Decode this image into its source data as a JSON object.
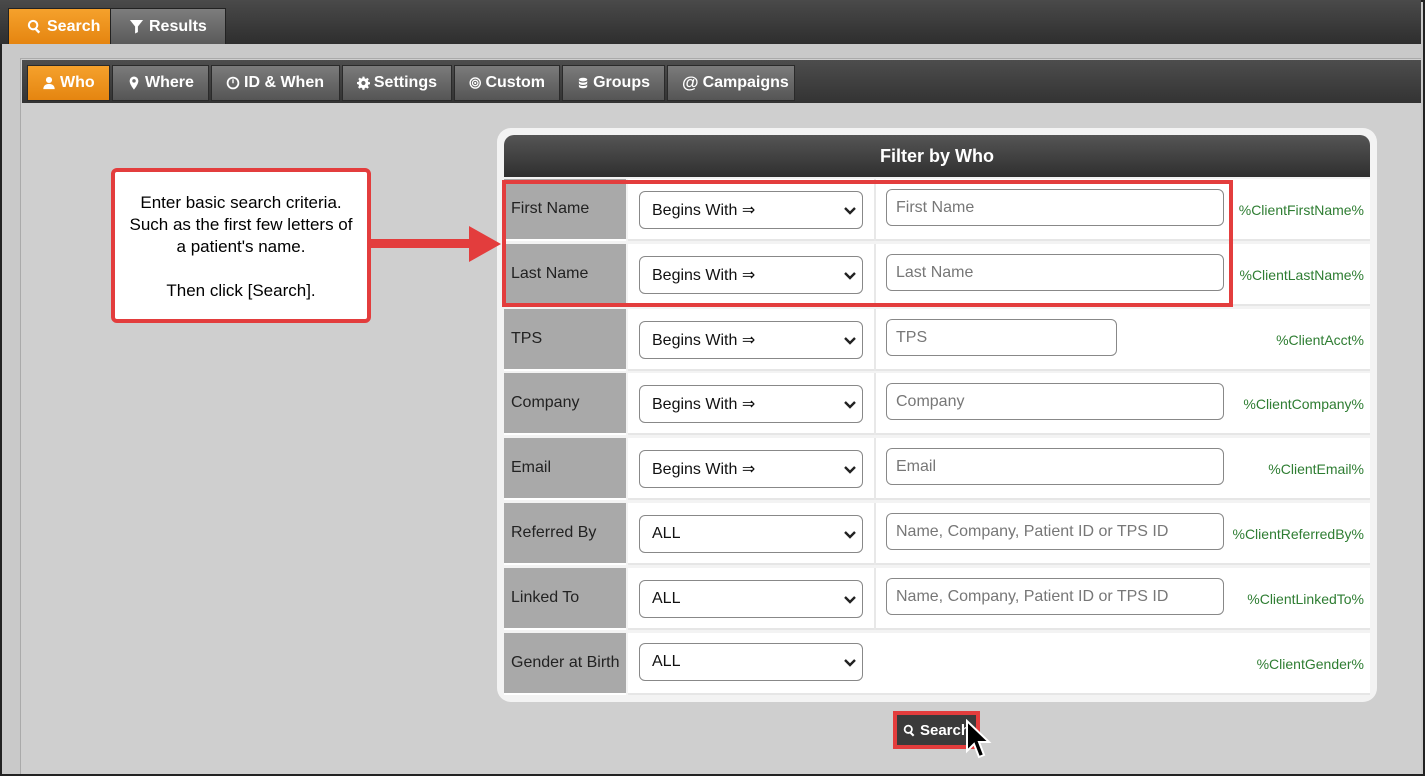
{
  "top_tabs": [
    {
      "label": "Search",
      "icon": "search-icon",
      "active": true
    },
    {
      "label": "Results",
      "icon": "filter-icon",
      "active": false
    }
  ],
  "sub_tabs": [
    {
      "label": "Who",
      "icon": "user-icon",
      "active": true
    },
    {
      "label": "Where",
      "icon": "map-pin-icon",
      "active": false
    },
    {
      "label": "ID & When",
      "icon": "clock-icon",
      "active": false
    },
    {
      "label": "Settings",
      "icon": "gear-icon",
      "active": false
    },
    {
      "label": "Custom",
      "icon": "bullseye-icon",
      "active": false
    },
    {
      "label": "Groups",
      "icon": "groups-icon",
      "active": false
    },
    {
      "label": "Campaigns",
      "icon": "at-icon",
      "active": false
    }
  ],
  "panel": {
    "title": "Filter by Who",
    "rows": [
      {
        "label": "First Name",
        "operator": "Begins With ⇒",
        "placeholder": "First Name",
        "variable": "%ClientFirstName%"
      },
      {
        "label": "Last Name",
        "operator": "Begins With ⇒",
        "placeholder": "Last Name",
        "variable": "%ClientLastName%"
      },
      {
        "label": "TPS",
        "operator": "Begins With ⇒",
        "placeholder": "TPS",
        "variable": "%ClientAcct%"
      },
      {
        "label": "Company",
        "operator": "Begins With ⇒",
        "placeholder": "Company",
        "variable": "%ClientCompany%"
      },
      {
        "label": "Email",
        "operator": "Begins With ⇒",
        "placeholder": "Email",
        "variable": "%ClientEmail%"
      },
      {
        "label": "Referred By",
        "operator": "ALL",
        "placeholder": "Name, Company, Patient ID or TPS ID",
        "variable": "%ClientReferredBy%"
      },
      {
        "label": "Linked To",
        "operator": "ALL",
        "placeholder": "Name, Company, Patient ID or TPS ID",
        "variable": "%ClientLinkedTo%"
      },
      {
        "label": "Gender at Birth",
        "operator": "ALL",
        "variable": "%ClientGender%"
      }
    ]
  },
  "callout": {
    "line1": "Enter basic search criteria.",
    "line2": "Such as the first few letters of",
    "line3": "a patient's name.",
    "line4": "Then click [Search]."
  },
  "search_button": {
    "label": "Search",
    "icon": "search-icon"
  },
  "colors": {
    "accent": "#f39a21",
    "highlight": "#e33d3d",
    "variable_text": "#2e7d32"
  }
}
